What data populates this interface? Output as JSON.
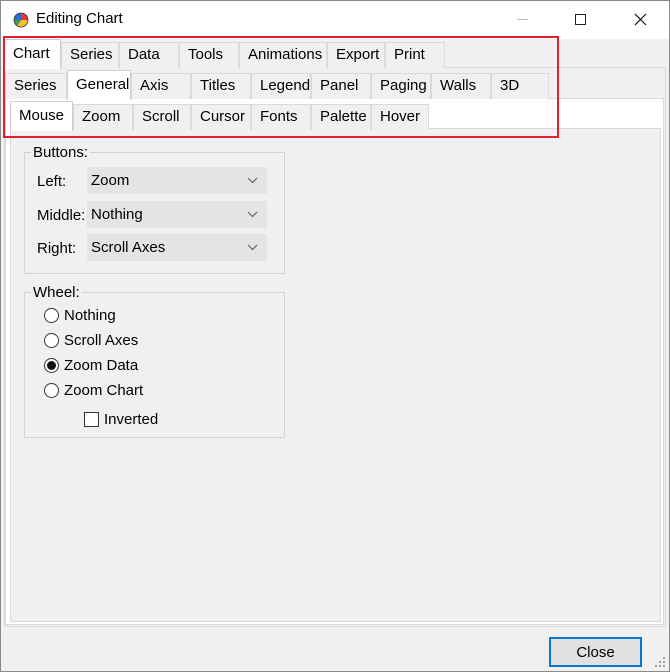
{
  "window": {
    "title": "Editing Chart",
    "icon": "tchart-icon"
  },
  "tabs_level1": [
    {
      "label": "Chart",
      "selected": true
    },
    {
      "label": "Series",
      "selected": false
    },
    {
      "label": "Data",
      "selected": false
    },
    {
      "label": "Tools",
      "selected": false
    },
    {
      "label": "Animations",
      "selected": false
    },
    {
      "label": "Export",
      "selected": false
    },
    {
      "label": "Print",
      "selected": false
    }
  ],
  "tabs_level2": [
    {
      "label": "Series",
      "selected": false
    },
    {
      "label": "General",
      "selected": true
    },
    {
      "label": "Axis",
      "selected": false
    },
    {
      "label": "Titles",
      "selected": false
    },
    {
      "label": "Legend",
      "selected": false
    },
    {
      "label": "Panel",
      "selected": false
    },
    {
      "label": "Paging",
      "selected": false
    },
    {
      "label": "Walls",
      "selected": false
    },
    {
      "label": "3D",
      "selected": false
    }
  ],
  "tabs_level3": [
    {
      "label": "Mouse",
      "selected": true
    },
    {
      "label": "Zoom",
      "selected": false
    },
    {
      "label": "Scroll",
      "selected": false
    },
    {
      "label": "Cursor",
      "selected": false
    },
    {
      "label": "Fonts",
      "selected": false
    },
    {
      "label": "Palette",
      "selected": false
    },
    {
      "label": "Hover",
      "selected": false
    }
  ],
  "buttons_group": {
    "title": "Buttons:",
    "left_label": "Left:",
    "left_value": "Zoom",
    "middle_label": "Middle:",
    "middle_value": "Nothing",
    "right_label": "Right:",
    "right_value": "Scroll Axes"
  },
  "wheel_group": {
    "title": "Wheel:",
    "options": [
      {
        "label": "Nothing",
        "checked": false
      },
      {
        "label": "Scroll Axes",
        "checked": false
      },
      {
        "label": "Zoom Data",
        "checked": true
      },
      {
        "label": "Zoom Chart",
        "checked": false
      }
    ],
    "inverted_label": "Inverted",
    "inverted_checked": false
  },
  "footer": {
    "close_label": "Close"
  },
  "colors": {
    "highlight": "#e0202c",
    "focus": "#0078d7"
  }
}
